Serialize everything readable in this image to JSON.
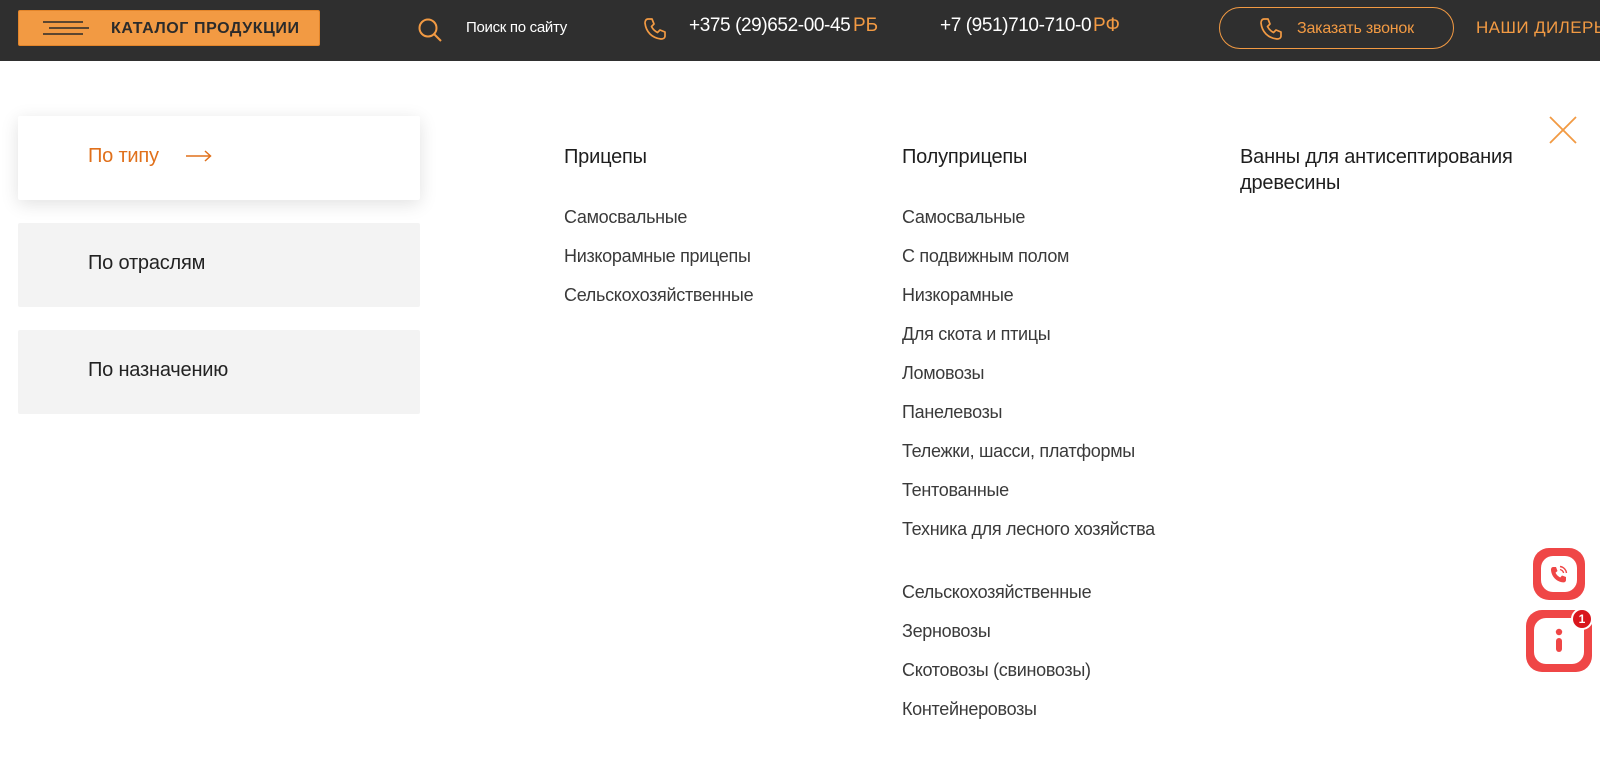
{
  "header": {
    "catalog_label": "КАТАЛОГ ПРОДУКЦИИ",
    "search_label": "Поиск по сайту",
    "phones": [
      {
        "number": "+375 (29)652-00-45",
        "region": "РБ"
      },
      {
        "number": "+7 (951)710-710-0",
        "region": "РФ"
      }
    ],
    "callback_label": "Заказать звонок",
    "dealers_label": "НАШИ ДИЛЕРЫ"
  },
  "filters": [
    {
      "label": "По типу",
      "active": true
    },
    {
      "label": "По отраслям",
      "active": false
    },
    {
      "label": "По назначению",
      "active": false
    }
  ],
  "columns": [
    {
      "title": "Прицепы",
      "items": [
        "Самосвальные",
        "Низкорамные прицепы",
        "Сельскохозяйственные"
      ]
    },
    {
      "title": "Полуприцепы",
      "items": [
        "Самосвальные",
        "С подвижным полом",
        "Низкорамные",
        "Для скота и птицы",
        "Ломовозы",
        "Панелевозы",
        "Тележки, шасси, платформы",
        "Тентованные",
        "Техника для лесного хозяйства",
        "Сельскохозяйственные",
        "Зерновозы",
        "Скотовозы (свиновозы)",
        "Контейнеровозы"
      ]
    },
    {
      "title": "Ванны для антисептирования древесины",
      "items": []
    }
  ],
  "widgets": {
    "chat_badge_count": "1"
  },
  "icons": {
    "menu": "burger-icon",
    "search": "search-icon",
    "phone": "phone-icon",
    "arrow": "arrow-right-icon",
    "close": "close-icon",
    "viber": "viber-icon",
    "chat": "chat-icon"
  },
  "colors": {
    "header_bg": "#2f2f2f",
    "accent": "#f29a43",
    "active_text": "#e0701b",
    "widget": "#ef4646",
    "badge": "#d9161d"
  }
}
